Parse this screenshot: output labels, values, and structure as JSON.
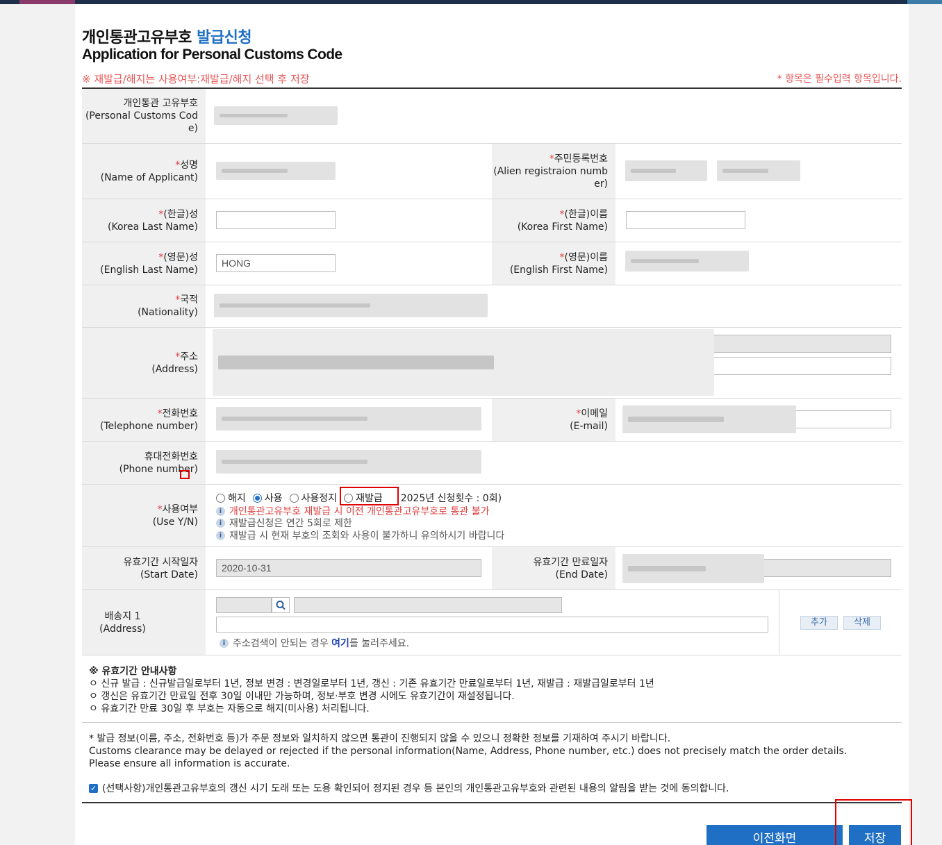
{
  "header": {
    "title_ko_main": "개인통관고유부호 ",
    "title_ko_accent": "발급신청",
    "title_en": "Application for Personal Customs Code",
    "notice": "※ 재발급/해지는 사용여부:재발급/해지 선택 후 저장",
    "required_note": "* 항목은 필수입력 항목입니다."
  },
  "fields": {
    "pccc": {
      "label_ko": "개인통관 고유부호",
      "label_en1": "(Personal Customs Cod",
      "label_en2": "e)"
    },
    "name": {
      "label_ko": "성명",
      "label_en": "(Name of Applicant)"
    },
    "alien": {
      "label_ko": "주민등록번호",
      "label_en1": "(Alien registraion numb",
      "label_en2": "er)"
    },
    "kr_last": {
      "label_ko": "(한글)성",
      "label_en": "(Korea Last Name)",
      "value": ""
    },
    "kr_first": {
      "label_ko": "(한글)이름",
      "label_en": "(Korea First Name)",
      "value": ""
    },
    "en_last": {
      "label_ko": "(영문)성",
      "label_en": "(English Last Name)",
      "value": "HONG"
    },
    "en_first": {
      "label_ko": "(영문)이름",
      "label_en": "(English First Name)"
    },
    "nationality": {
      "label_ko": "국적",
      "label_en": "(Nationality)"
    },
    "address": {
      "label_ko": "주소",
      "label_en": "(Address)"
    },
    "telephone": {
      "label_ko": "전화번호",
      "label_en": "(Telephone number)"
    },
    "email": {
      "label_ko": "이메일",
      "label_en": "(E-mail)"
    },
    "mobile": {
      "label_ko": "휴대전화번호",
      "label_en": "(Phone number)"
    },
    "use": {
      "label_ko": "사용여부",
      "label_en": "(Use Y/N)",
      "options": [
        "해지",
        "사용",
        "사용정지",
        "재발급"
      ],
      "selected": "사용",
      "count_text": "2025년 신청횟수 : 0회)",
      "info1": "개인통관고유부호 재발급 시 이전 개인통관고유부호로 통관 불가",
      "info2": "재발급신청은 연간 5회로 제한",
      "info3": "재발급 시 현재 부호의 조회와 사용이 불가하니 유의하시기 바랍니다"
    },
    "start_date": {
      "label_ko": "유효기간 시작일자",
      "label_en": "(Start Date)",
      "value": "2020-10-31"
    },
    "end_date": {
      "label_ko": "유효기간 만료일자",
      "label_en": "(End Date)"
    },
    "shipping": {
      "label_ko": "배송지 1",
      "label_en": "(Address)",
      "hint_before": "주소검색이 안되는 경우 ",
      "hint_link": "여기",
      "hint_after": "를 눌러주세요.",
      "add_label": "추가",
      "delete_label": "삭제"
    }
  },
  "guide": {
    "title": "※ 유효기간 안내사항",
    "line1": "ㅇ 신규 발급 : 신규발급일로부터 1년, 정보 변경 : 변경일로부터 1년, 갱신 : 기존 유효기간 만료일로부터 1년, 재발급 : 재발급일로부터 1년",
    "line2": "ㅇ 갱신은 유효기간 만료일 전후 30일 이내만 가능하며, 정보·부호 변경 시에도 유효기간이 재설정됩니다.",
    "line3": "ㅇ 유효기간 만료 30일 후 부호는 자동으로 해지(미사용) 처리됩니다."
  },
  "warning": {
    "ko": "* 발급 정보(이름, 주소, 전화번호 등)가 주문 정보와 일치하지 않으면 통관이 진행되지 않을 수 있으니 정확한 정보를 기재하여 주시기 바랍니다.",
    "en1": "Customs clearance may be delayed or rejected if the personal information(Name, Address, Phone number, etc.) does not precisely match the order details.",
    "en2": "Please ensure all information is accurate."
  },
  "consent": {
    "text": "(선택사항)개인통관고유부호의 갱신 시기 도래 또는 도용 확인되어 정지된 경우 등 본인의 개인통관고유부호와 관련된 내용의 알림을 받는 것에 동의합니다.",
    "checked": true
  },
  "buttons": {
    "prev": "이전화면",
    "save": "저장"
  },
  "colors": {
    "accent": "#1f6fc4",
    "required": "#e04040",
    "highlight": "#e00000"
  },
  "icons": {
    "search": "search-icon",
    "info": "info-icon",
    "check": "checkbox-checked-icon"
  }
}
